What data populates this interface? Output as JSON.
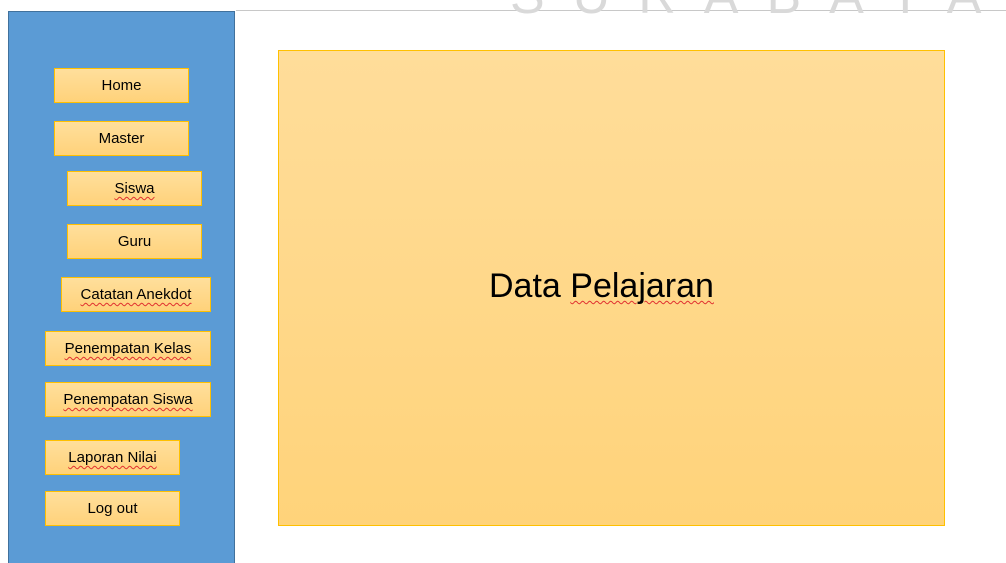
{
  "watermark": {
    "text": "SURABAYA"
  },
  "sidebar": {
    "items": [
      {
        "label": "Home"
      },
      {
        "label": "Master"
      },
      {
        "label": "Siswa"
      },
      {
        "label": "Guru"
      },
      {
        "label": "Catatan Anekdot"
      },
      {
        "label": "Penempatan Kelas"
      },
      {
        "label": "Penempatan Siswa"
      },
      {
        "label": "Laporan Nilai"
      },
      {
        "label": "Log out"
      }
    ]
  },
  "main": {
    "title_word1": "Data",
    "title_word2": "Pelajaran"
  },
  "colors": {
    "sidebar_bg": "#5b9bd5",
    "button_fill": "#ffd98e",
    "button_border": "#ffc000",
    "panel_fill": "#ffd98e"
  }
}
